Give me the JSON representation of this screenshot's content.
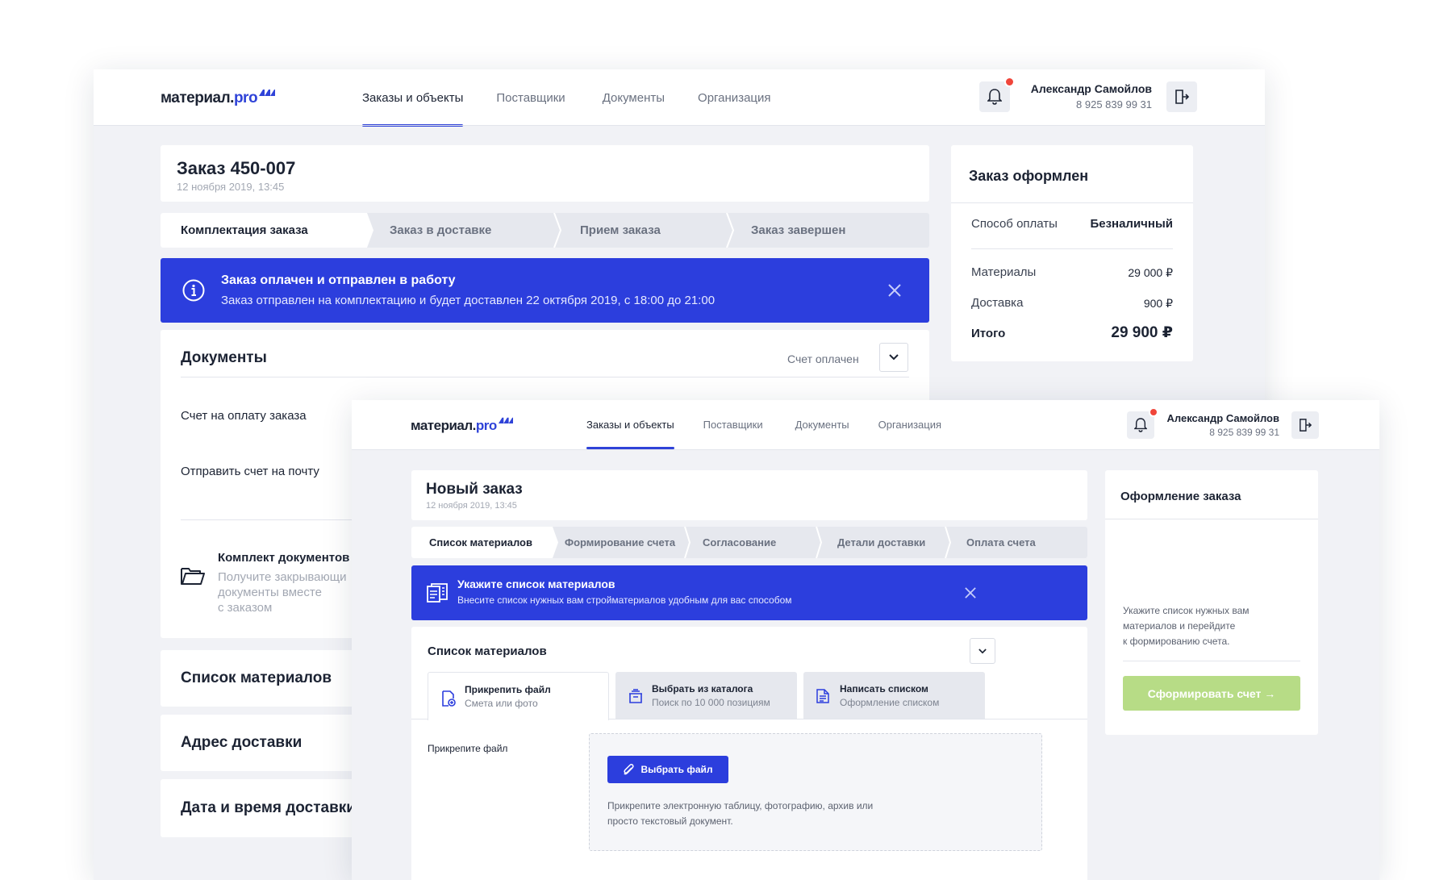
{
  "brand": {
    "logo_main": "материал.",
    "logo_pro": "pro"
  },
  "nav": [
    "Заказы и объекты",
    "Поставщики",
    "Документы",
    "Организация"
  ],
  "user": {
    "name": "Александр Самойлов",
    "phone": "8 925 839 99 31"
  },
  "back": {
    "order": {
      "title": "Заказ 450-007",
      "date": "12 ноября 2019, 13:45"
    },
    "steps": [
      "Комплектация заказа",
      "Заказ в доставке",
      "Прием заказа",
      "Заказ завершен"
    ],
    "banner": {
      "title": "Заказ оплачен и отправлен в работу",
      "text": "Заказ отправлен на комплектацию и будет доставлен 22 октября 2019, с 18:00 до 21:00"
    },
    "documents": {
      "title": "Документы",
      "status": "Счет оплачен",
      "item1": "Счет на оплату заказа",
      "item2": "Отправить счет на почту",
      "kit_title": "Комплект документов",
      "kit_line1": "Получите закрывающи",
      "kit_line2": "документы вместе",
      "kit_line3": "с заказом"
    },
    "sections": [
      "Список материалов",
      "Адрес доставки",
      "Дата и время доставки"
    ],
    "summary": {
      "title": "Заказ оформлен",
      "payment_label": "Способ оплаты",
      "payment_value": "Безналичный",
      "materials_label": "Материалы",
      "materials_value": "29 000 ₽",
      "delivery_label": "Доставка",
      "delivery_value": "900 ₽",
      "total_label": "Итого",
      "total_value": "29 900 ₽"
    }
  },
  "front": {
    "order": {
      "title": "Новый заказ",
      "date": "12 ноября 2019, 13:45"
    },
    "steps": [
      "Список материалов",
      "Формирование счета",
      "Согласование",
      "Детали доставки",
      "Оплата счета"
    ],
    "banner": {
      "title": "Укажите список материалов",
      "text": "Внесите список нужных вам стройматериалов удобным для вас способом"
    },
    "materials": {
      "title": "Список материалов",
      "tabs": [
        {
          "title": "Прикрепить файл",
          "sub": "Смета или фото"
        },
        {
          "title": "Выбрать из каталога",
          "sub": "Поиск по 10 000 позициям"
        },
        {
          "title": "Написать списком",
          "sub": "Оформление списком"
        }
      ],
      "attach_label": "Прикрепите файл",
      "choose_button": "Выбрать файл",
      "hint_line1": "Прикрепите электронную таблицу, фотографию, архив или",
      "hint_line2": "просто текстовый документ."
    },
    "sidebar": {
      "title": "Оформление заказа",
      "hint_line1": "Укажите список нужных вам",
      "hint_line2": "материалов и перейдите",
      "hint_line3": "к формированию счета.",
      "button": "Сформировать счет →"
    }
  },
  "colors": {
    "accent": "#2c3edd",
    "notification": "#f0453a",
    "cta_disabled": "#b7dc86",
    "background": "#f1f2f6"
  }
}
